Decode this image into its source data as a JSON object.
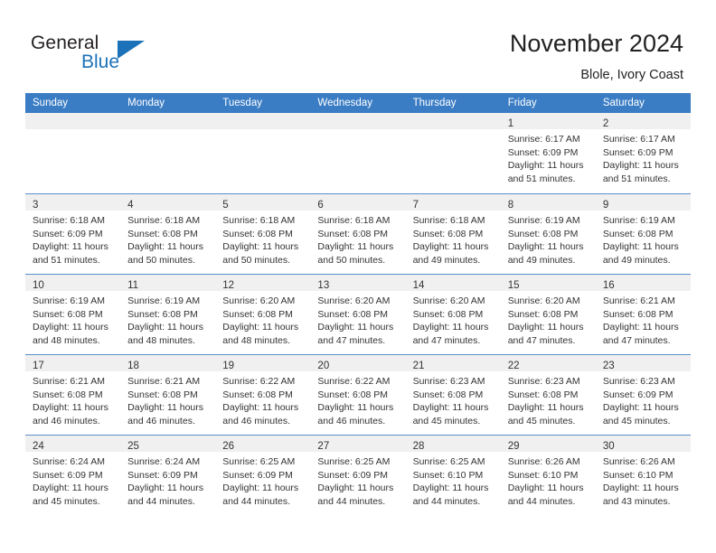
{
  "brand": {
    "name_part1": "General",
    "name_part2": "Blue",
    "accent_color": "#1b72b8"
  },
  "header": {
    "title": "November 2024",
    "subtitle": "Blole, Ivory Coast"
  },
  "theme": {
    "header_row_bg": "#3b7dc4",
    "day_band_bg": "#f0f0f0",
    "text": "#333333"
  },
  "calendar": {
    "weekdays": [
      "Sunday",
      "Monday",
      "Tuesday",
      "Wednesday",
      "Thursday",
      "Friday",
      "Saturday"
    ],
    "labels": {
      "sunrise": "Sunrise:",
      "sunset": "Sunset:",
      "daylight": "Daylight:"
    },
    "weeks": [
      [
        {
          "day": "",
          "empty": true
        },
        {
          "day": "",
          "empty": true
        },
        {
          "day": "",
          "empty": true
        },
        {
          "day": "",
          "empty": true
        },
        {
          "day": "",
          "empty": true
        },
        {
          "day": "1",
          "sunrise": "Sunrise: 6:17 AM",
          "sunset": "Sunset: 6:09 PM",
          "daylight_l1": "Daylight: 11 hours",
          "daylight_l2": "and 51 minutes."
        },
        {
          "day": "2",
          "sunrise": "Sunrise: 6:17 AM",
          "sunset": "Sunset: 6:09 PM",
          "daylight_l1": "Daylight: 11 hours",
          "daylight_l2": "and 51 minutes."
        }
      ],
      [
        {
          "day": "3",
          "sunrise": "Sunrise: 6:18 AM",
          "sunset": "Sunset: 6:09 PM",
          "daylight_l1": "Daylight: 11 hours",
          "daylight_l2": "and 51 minutes."
        },
        {
          "day": "4",
          "sunrise": "Sunrise: 6:18 AM",
          "sunset": "Sunset: 6:08 PM",
          "daylight_l1": "Daylight: 11 hours",
          "daylight_l2": "and 50 minutes."
        },
        {
          "day": "5",
          "sunrise": "Sunrise: 6:18 AM",
          "sunset": "Sunset: 6:08 PM",
          "daylight_l1": "Daylight: 11 hours",
          "daylight_l2": "and 50 minutes."
        },
        {
          "day": "6",
          "sunrise": "Sunrise: 6:18 AM",
          "sunset": "Sunset: 6:08 PM",
          "daylight_l1": "Daylight: 11 hours",
          "daylight_l2": "and 50 minutes."
        },
        {
          "day": "7",
          "sunrise": "Sunrise: 6:18 AM",
          "sunset": "Sunset: 6:08 PM",
          "daylight_l1": "Daylight: 11 hours",
          "daylight_l2": "and 49 minutes."
        },
        {
          "day": "8",
          "sunrise": "Sunrise: 6:19 AM",
          "sunset": "Sunset: 6:08 PM",
          "daylight_l1": "Daylight: 11 hours",
          "daylight_l2": "and 49 minutes."
        },
        {
          "day": "9",
          "sunrise": "Sunrise: 6:19 AM",
          "sunset": "Sunset: 6:08 PM",
          "daylight_l1": "Daylight: 11 hours",
          "daylight_l2": "and 49 minutes."
        }
      ],
      [
        {
          "day": "10",
          "sunrise": "Sunrise: 6:19 AM",
          "sunset": "Sunset: 6:08 PM",
          "daylight_l1": "Daylight: 11 hours",
          "daylight_l2": "and 48 minutes."
        },
        {
          "day": "11",
          "sunrise": "Sunrise: 6:19 AM",
          "sunset": "Sunset: 6:08 PM",
          "daylight_l1": "Daylight: 11 hours",
          "daylight_l2": "and 48 minutes."
        },
        {
          "day": "12",
          "sunrise": "Sunrise: 6:20 AM",
          "sunset": "Sunset: 6:08 PM",
          "daylight_l1": "Daylight: 11 hours",
          "daylight_l2": "and 48 minutes."
        },
        {
          "day": "13",
          "sunrise": "Sunrise: 6:20 AM",
          "sunset": "Sunset: 6:08 PM",
          "daylight_l1": "Daylight: 11 hours",
          "daylight_l2": "and 47 minutes."
        },
        {
          "day": "14",
          "sunrise": "Sunrise: 6:20 AM",
          "sunset": "Sunset: 6:08 PM",
          "daylight_l1": "Daylight: 11 hours",
          "daylight_l2": "and 47 minutes."
        },
        {
          "day": "15",
          "sunrise": "Sunrise: 6:20 AM",
          "sunset": "Sunset: 6:08 PM",
          "daylight_l1": "Daylight: 11 hours",
          "daylight_l2": "and 47 minutes."
        },
        {
          "day": "16",
          "sunrise": "Sunrise: 6:21 AM",
          "sunset": "Sunset: 6:08 PM",
          "daylight_l1": "Daylight: 11 hours",
          "daylight_l2": "and 47 minutes."
        }
      ],
      [
        {
          "day": "17",
          "sunrise": "Sunrise: 6:21 AM",
          "sunset": "Sunset: 6:08 PM",
          "daylight_l1": "Daylight: 11 hours",
          "daylight_l2": "and 46 minutes."
        },
        {
          "day": "18",
          "sunrise": "Sunrise: 6:21 AM",
          "sunset": "Sunset: 6:08 PM",
          "daylight_l1": "Daylight: 11 hours",
          "daylight_l2": "and 46 minutes."
        },
        {
          "day": "19",
          "sunrise": "Sunrise: 6:22 AM",
          "sunset": "Sunset: 6:08 PM",
          "daylight_l1": "Daylight: 11 hours",
          "daylight_l2": "and 46 minutes."
        },
        {
          "day": "20",
          "sunrise": "Sunrise: 6:22 AM",
          "sunset": "Sunset: 6:08 PM",
          "daylight_l1": "Daylight: 11 hours",
          "daylight_l2": "and 46 minutes."
        },
        {
          "day": "21",
          "sunrise": "Sunrise: 6:23 AM",
          "sunset": "Sunset: 6:08 PM",
          "daylight_l1": "Daylight: 11 hours",
          "daylight_l2": "and 45 minutes."
        },
        {
          "day": "22",
          "sunrise": "Sunrise: 6:23 AM",
          "sunset": "Sunset: 6:08 PM",
          "daylight_l1": "Daylight: 11 hours",
          "daylight_l2": "and 45 minutes."
        },
        {
          "day": "23",
          "sunrise": "Sunrise: 6:23 AM",
          "sunset": "Sunset: 6:09 PM",
          "daylight_l1": "Daylight: 11 hours",
          "daylight_l2": "and 45 minutes."
        }
      ],
      [
        {
          "day": "24",
          "sunrise": "Sunrise: 6:24 AM",
          "sunset": "Sunset: 6:09 PM",
          "daylight_l1": "Daylight: 11 hours",
          "daylight_l2": "and 45 minutes."
        },
        {
          "day": "25",
          "sunrise": "Sunrise: 6:24 AM",
          "sunset": "Sunset: 6:09 PM",
          "daylight_l1": "Daylight: 11 hours",
          "daylight_l2": "and 44 minutes."
        },
        {
          "day": "26",
          "sunrise": "Sunrise: 6:25 AM",
          "sunset": "Sunset: 6:09 PM",
          "daylight_l1": "Daylight: 11 hours",
          "daylight_l2": "and 44 minutes."
        },
        {
          "day": "27",
          "sunrise": "Sunrise: 6:25 AM",
          "sunset": "Sunset: 6:09 PM",
          "daylight_l1": "Daylight: 11 hours",
          "daylight_l2": "and 44 minutes."
        },
        {
          "day": "28",
          "sunrise": "Sunrise: 6:25 AM",
          "sunset": "Sunset: 6:10 PM",
          "daylight_l1": "Daylight: 11 hours",
          "daylight_l2": "and 44 minutes."
        },
        {
          "day": "29",
          "sunrise": "Sunrise: 6:26 AM",
          "sunset": "Sunset: 6:10 PM",
          "daylight_l1": "Daylight: 11 hours",
          "daylight_l2": "and 44 minutes."
        },
        {
          "day": "30",
          "sunrise": "Sunrise: 6:26 AM",
          "sunset": "Sunset: 6:10 PM",
          "daylight_l1": "Daylight: 11 hours",
          "daylight_l2": "and 43 minutes."
        }
      ]
    ]
  }
}
